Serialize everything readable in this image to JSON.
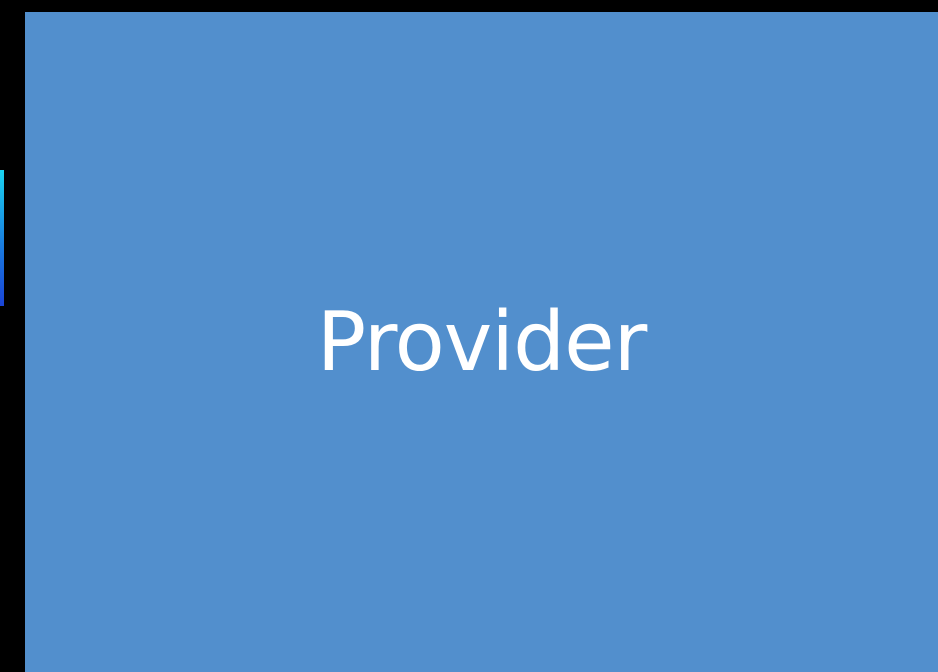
{
  "panel": {
    "label": "Provider",
    "background_color": "#528fcd",
    "text_color": "#ffffff"
  },
  "accent": {
    "colors": [
      "#1ad4f0",
      "#1a7de0",
      "#1a44d6"
    ]
  },
  "page_background": "#000000"
}
